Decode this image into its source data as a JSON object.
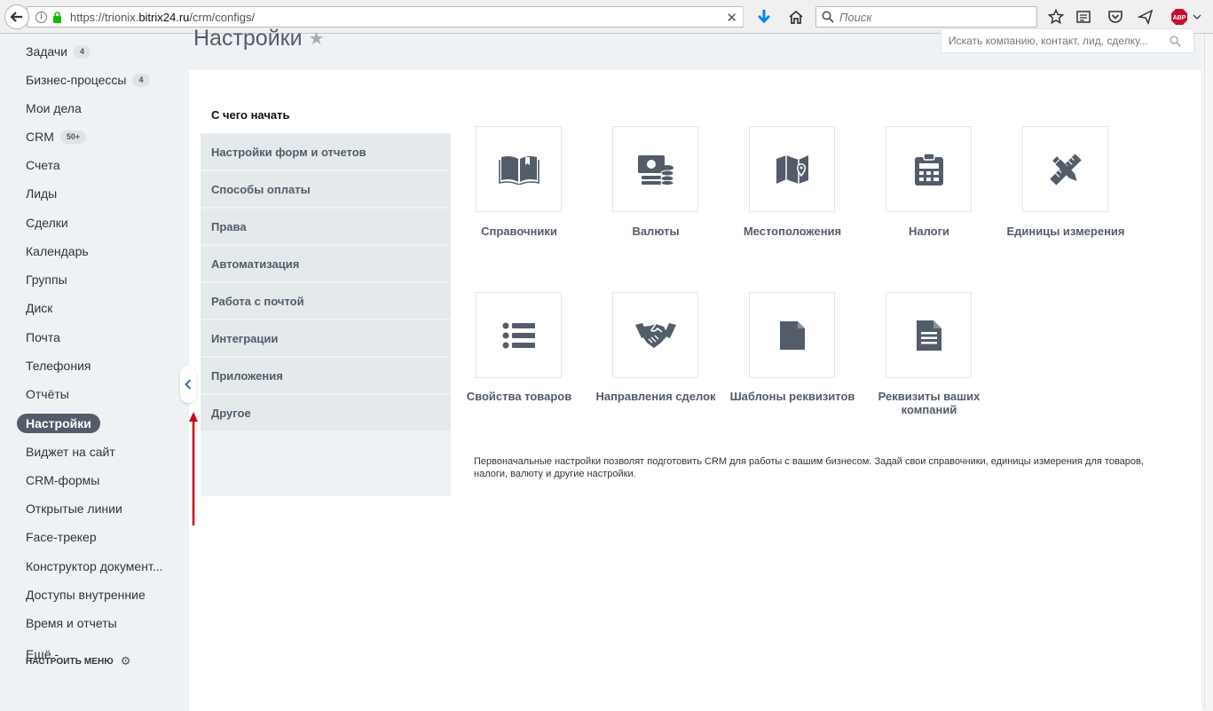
{
  "browser": {
    "url_prefix": "https://trionix.",
    "url_domain": "bitrix24.ru",
    "url_path": "/crm/configs/",
    "search_placeholder": "Поиск",
    "adblock_label": "ABP"
  },
  "left_menu": {
    "items": [
      {
        "label": "Задачи",
        "badge": "4"
      },
      {
        "label": "Бизнес-процессы",
        "badge": "4"
      },
      {
        "label": "Мои дела"
      },
      {
        "label": "CRM",
        "badge": "50+"
      },
      {
        "label": "Счета"
      },
      {
        "label": "Лиды"
      },
      {
        "label": "Сделки"
      },
      {
        "label": "Календарь"
      },
      {
        "label": "Группы"
      },
      {
        "label": "Диск"
      },
      {
        "label": "Почта"
      },
      {
        "label": "Телефония"
      },
      {
        "label": "Отчёты"
      },
      {
        "label": "Настройки",
        "active": true
      },
      {
        "label": "Виджет на сайт"
      },
      {
        "label": "CRM-формы"
      },
      {
        "label": "Открытые линии"
      },
      {
        "label": "Face-трекер"
      },
      {
        "label": "Конструктор документ..."
      },
      {
        "label": "Доступы внутренние"
      },
      {
        "label": "Время и отчеты"
      },
      {
        "label": "Ещё -"
      }
    ],
    "configure_label": "НАСТРОИТЬ МЕНЮ"
  },
  "header": {
    "title": "Настройки",
    "search_placeholder": "Искать компанию, контакт, лид, сделку..."
  },
  "nav": {
    "items": [
      {
        "label": "С чего начать",
        "active": true
      },
      {
        "label": "Настройки форм и отчетов"
      },
      {
        "label": "Способы оплаты"
      },
      {
        "label": "Права"
      },
      {
        "label": "Автоматизация"
      },
      {
        "label": "Работа с почтой"
      },
      {
        "label": "Интеграции"
      },
      {
        "label": "Приложения"
      },
      {
        "label": "Другое"
      }
    ]
  },
  "tiles": [
    {
      "label": "Справочники",
      "icon": "book-icon"
    },
    {
      "label": "Валюты",
      "icon": "currency-icon"
    },
    {
      "label": "Местоположения",
      "icon": "map-icon"
    },
    {
      "label": "Налоги",
      "icon": "calculator-icon"
    },
    {
      "label": "Единицы измерения",
      "icon": "ruler-pencil-icon"
    },
    {
      "label": "Свойства товаров",
      "icon": "list-icon"
    },
    {
      "label": "Направления сделок",
      "icon": "handshake-icon"
    },
    {
      "label": "Шаблоны реквизитов",
      "icon": "document-template-icon"
    },
    {
      "label": "Реквизиты ваших компаний",
      "icon": "document-text-icon"
    }
  ],
  "description": "Первоначальные настройки позволят подготовить CRM для работы с вашим бизнесом. Задай свои справочники, единицы измерения для товаров, налоги, валюту и другие настройки.",
  "colors": {
    "accent": "#535c69",
    "icon": "#535c69",
    "annotation_arrow": "#d0021b",
    "download_arrow": "#0a84ff",
    "adblock": "#c8102e"
  }
}
